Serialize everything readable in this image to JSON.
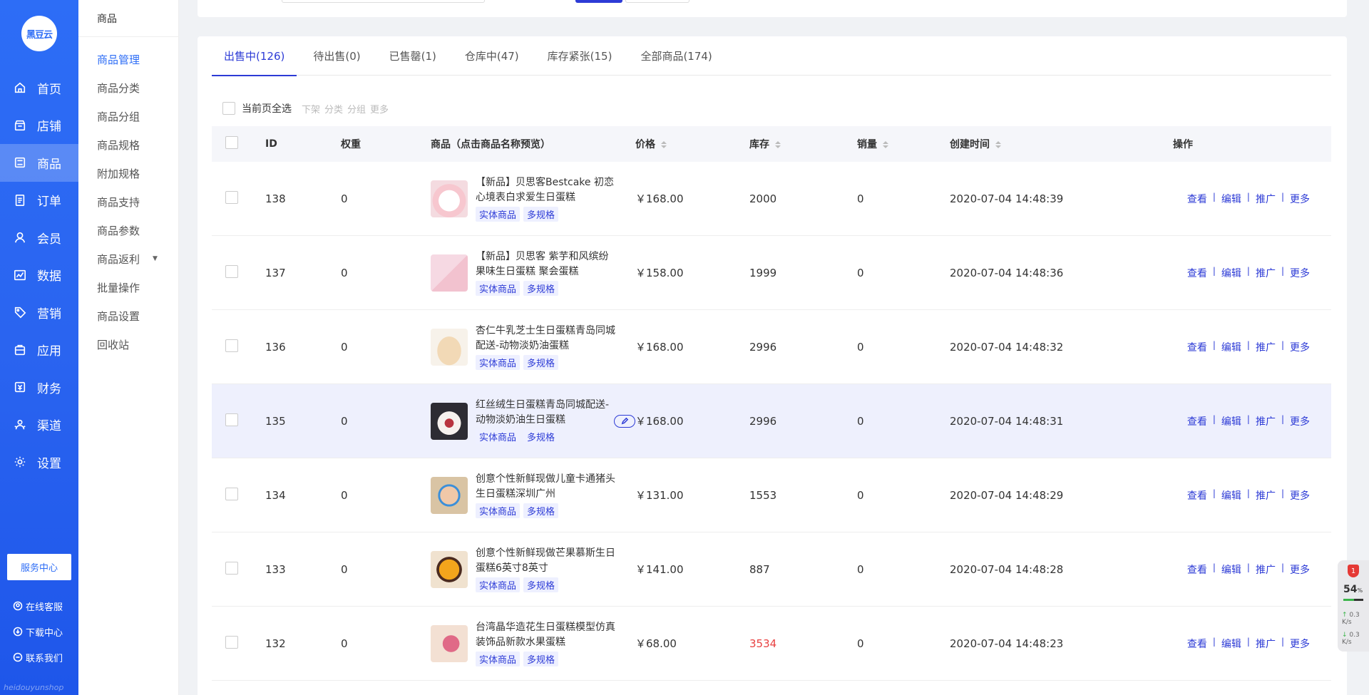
{
  "brand": {
    "logo_text": "黑豆云",
    "watermark": "heidouyunshop"
  },
  "nav": [
    {
      "label": "首页",
      "icon": "home-icon"
    },
    {
      "label": "店铺",
      "icon": "store-icon"
    },
    {
      "label": "商品",
      "icon": "goods-icon",
      "active": true
    },
    {
      "label": "订单",
      "icon": "order-icon"
    },
    {
      "label": "会员",
      "icon": "member-icon"
    },
    {
      "label": "数据",
      "icon": "chart-icon"
    },
    {
      "label": "营销",
      "icon": "tag-icon"
    },
    {
      "label": "应用",
      "icon": "app-icon"
    },
    {
      "label": "财务",
      "icon": "finance-icon"
    },
    {
      "label": "渠道",
      "icon": "channel-icon"
    },
    {
      "label": "设置",
      "icon": "gear-icon"
    }
  ],
  "service_center": "服务中心",
  "footer_links": [
    {
      "label": "在线客服",
      "icon": "avatar-icon"
    },
    {
      "label": "下载中心",
      "icon": "download-icon"
    },
    {
      "label": "联系我们",
      "icon": "contact-icon"
    }
  ],
  "subnav": {
    "title": "商品",
    "items": [
      {
        "label": "商品管理",
        "active": true
      },
      {
        "label": "商品分类"
      },
      {
        "label": "商品分组"
      },
      {
        "label": "商品规格"
      },
      {
        "label": "附加规格"
      },
      {
        "label": "商品支持"
      },
      {
        "label": "商品参数"
      },
      {
        "label": "商品返利",
        "caret": true
      },
      {
        "label": "批量操作"
      },
      {
        "label": "商品设置"
      },
      {
        "label": "回收站"
      }
    ]
  },
  "tabs": [
    {
      "label": "出售中(126)",
      "active": true
    },
    {
      "label": "待出售(0)"
    },
    {
      "label": "已售罄(1)"
    },
    {
      "label": "仓库中(47)"
    },
    {
      "label": "库存紧张(15)"
    },
    {
      "label": "全部商品(174)"
    }
  ],
  "batch": {
    "select_all_label": "当前页全选",
    "actions": [
      "下架",
      "分类",
      "分组",
      "更多"
    ]
  },
  "table": {
    "headers": {
      "id": "ID",
      "weight": "权重",
      "goods": "商品（点击商品名称预览）",
      "price": "价格",
      "stock": "库存",
      "sales": "销量",
      "created": "创建时间",
      "ops": "操作"
    },
    "tag_physical": "实体商品",
    "tag_multi": "多规格",
    "ops": [
      "查看",
      "编辑",
      "推广",
      "更多"
    ],
    "rows": [
      {
        "id": "138",
        "weight": "0",
        "name": "【新品】贝思客Bestcake 初恋心境表白求爱生日蛋糕",
        "price": "￥168.00",
        "stock": "2000",
        "sales": "0",
        "created": "2020-07-04 14:48:39",
        "thumb": "pink-cake"
      },
      {
        "id": "137",
        "weight": "0",
        "name": "【新品】贝思客 紫芋和风缤纷果味生日蛋糕 聚会蛋糕",
        "price": "￥158.00",
        "stock": "1999",
        "sales": "0",
        "created": "2020-07-04 14:48:36",
        "thumb": "box-cake"
      },
      {
        "id": "136",
        "weight": "0",
        "name": "杏仁牛乳芝士生日蛋糕青岛同城配送-动物淡奶油蛋糕",
        "price": "￥168.00",
        "stock": "2996",
        "sales": "0",
        "created": "2020-07-04 14:48:32",
        "thumb": "almond-cake"
      },
      {
        "id": "135",
        "weight": "0",
        "name": "红丝绒生日蛋糕青岛同城配送-动物淡奶油生日蛋糕",
        "price": "￥168.00",
        "stock": "2996",
        "sales": "0",
        "created": "2020-07-04 14:48:31",
        "thumb": "red-velvet-cake",
        "hover": true
      },
      {
        "id": "134",
        "weight": "0",
        "name": "创意个性新鲜现做儿童卡通猪头生日蛋糕深圳广州",
        "price": "￥131.00",
        "stock": "1553",
        "sales": "0",
        "created": "2020-07-04 14:48:29",
        "thumb": "pig-cake"
      },
      {
        "id": "133",
        "weight": "0",
        "name": "创意个性新鲜现做芒果慕斯生日蛋糕6英寸8英寸",
        "price": "￥141.00",
        "stock": "887",
        "sales": "0",
        "created": "2020-07-04 14:48:28",
        "thumb": "mango-cake"
      },
      {
        "id": "132",
        "weight": "0",
        "name": "台湾晶华造花生日蛋糕模型仿真装饰品新款水果蛋糕",
        "price": "￥68.00",
        "stock": "3534",
        "sales": "0",
        "created": "2020-07-04 14:48:23",
        "thumb": "flower-cake",
        "stock_alert": true
      }
    ]
  },
  "widget": {
    "badge": "1",
    "percent": "54",
    "percent_unit": "%",
    "up_speed": "0.3",
    "down_speed": "0.3",
    "speed_unit": "K/s",
    "level": 0.54
  }
}
